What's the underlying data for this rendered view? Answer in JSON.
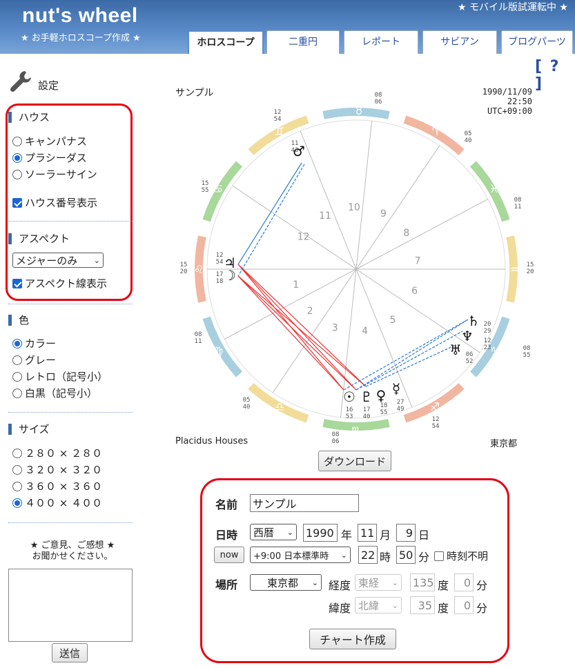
{
  "header": {
    "logo": "nut's wheel",
    "tagline": "★ お手軽ホロスコープ作成 ★",
    "mobile_notice": "★ モバイル版試運転中 ★",
    "tabs": [
      {
        "label": "ホロスコープ",
        "active": true
      },
      {
        "label": "二重円",
        "active": false
      },
      {
        "label": "レポート",
        "active": false
      },
      {
        "label": "サビアン",
        "active": false
      },
      {
        "label": "ブログパーツ",
        "active": false
      }
    ],
    "help": "[ ? ]"
  },
  "sidebar": {
    "settings_title": "設定",
    "house": {
      "title": "ハウス",
      "options": [
        {
          "label": "キャンパナス",
          "selected": false
        },
        {
          "label": "プラシーダス",
          "selected": true
        },
        {
          "label": "ソーラーサイン",
          "selected": false
        }
      ],
      "show_numbers": {
        "label": "ハウス番号表示",
        "checked": true
      }
    },
    "aspect": {
      "title": "アスペクト",
      "select": "メジャーのみ",
      "show_lines": {
        "label": "アスペクト線表示",
        "checked": true
      }
    },
    "color": {
      "title": "色",
      "options": [
        {
          "label": "カラー",
          "selected": true
        },
        {
          "label": "グレー",
          "selected": false
        },
        {
          "label": "レトロ（記号小）",
          "selected": false
        },
        {
          "label": "白黒（記号小）",
          "selected": false
        }
      ]
    },
    "size": {
      "title": "サイズ",
      "options": [
        {
          "label": "２８０ × ２８０",
          "selected": false
        },
        {
          "label": "３２０ × ３２０",
          "selected": false
        },
        {
          "label": "３６０ × ３６０",
          "selected": false
        },
        {
          "label": "４００ × ４００",
          "selected": true
        }
      ]
    },
    "feedback": {
      "line1": "★ ご意見、ご感想 ★",
      "line2": "お聞かせください。",
      "send": "送信"
    }
  },
  "chart": {
    "name": "サンプル",
    "date": "1990/11/09",
    "time": "22:50",
    "utc": "UTC+09:00",
    "house_system": "Placidus Houses",
    "place": "東京都",
    "download": "ダウンロード",
    "house_numbers": [
      "1",
      "2",
      "3",
      "4",
      "5",
      "6",
      "7",
      "8",
      "9",
      "10",
      "11",
      "12"
    ],
    "cusps": {
      "mc": "08\n06",
      "ic": "08\n06",
      "asc": "15\n20",
      "dsc": "15\n20",
      "c11": "12\n54",
      "c12": "15\n55",
      "c2": "08\n11",
      "c3": "05\n40",
      "c5": "12\n54",
      "c6": "08\n55",
      "c8": "08\n11",
      "c9": "05\n40"
    },
    "planets": {
      "mars": {
        "glyph": "♂",
        "deg": "11\n43"
      },
      "jupiter": {
        "glyph": "♃",
        "deg": "12\n54"
      },
      "moon": {
        "glyph": "☽",
        "deg": "17\n18"
      },
      "saturn": {
        "glyph": "♄",
        "deg": "20\n29"
      },
      "neptune": {
        "glyph": "♆",
        "deg": "12\n23"
      },
      "uranus": {
        "glyph": "♅",
        "deg": "06\n52"
      },
      "sun": {
        "glyph": "☉",
        "deg": "16\n53"
      },
      "pluto": {
        "glyph": "♇",
        "deg": "17\n40"
      },
      "venus": {
        "glyph": "♀",
        "deg": "18\n55"
      },
      "mercury": {
        "glyph": "☿",
        "deg": "27\n49"
      }
    },
    "signs": [
      "♈",
      "♉",
      "♊",
      "♋",
      "♌",
      "♍",
      "♎",
      "♏",
      "♐",
      "♑",
      "♒",
      "♓"
    ]
  },
  "form": {
    "name_label": "名前",
    "name_value": "サンプル",
    "datetime_label": "日時",
    "era": "西暦",
    "year": "1990",
    "year_unit": "年",
    "month": "11",
    "month_unit": "月",
    "day": "9",
    "day_unit": "日",
    "now": "now",
    "timezone": "+9:00 日本標準時",
    "hour": "22",
    "hour_unit": "時",
    "minute": "50",
    "minute_unit": "分",
    "unknown_time": "時刻不明",
    "place_label": "場所",
    "place": "東京都",
    "longitude_label": "経度",
    "longitude_dir": "東経",
    "longitude_deg": "135",
    "deg_unit": "度",
    "longitude_min": "0",
    "min_unit": "分",
    "latitude_label": "緯度",
    "latitude_dir": "北緯",
    "latitude_deg": "35",
    "latitude_min": "0",
    "create": "チャート作成"
  }
}
